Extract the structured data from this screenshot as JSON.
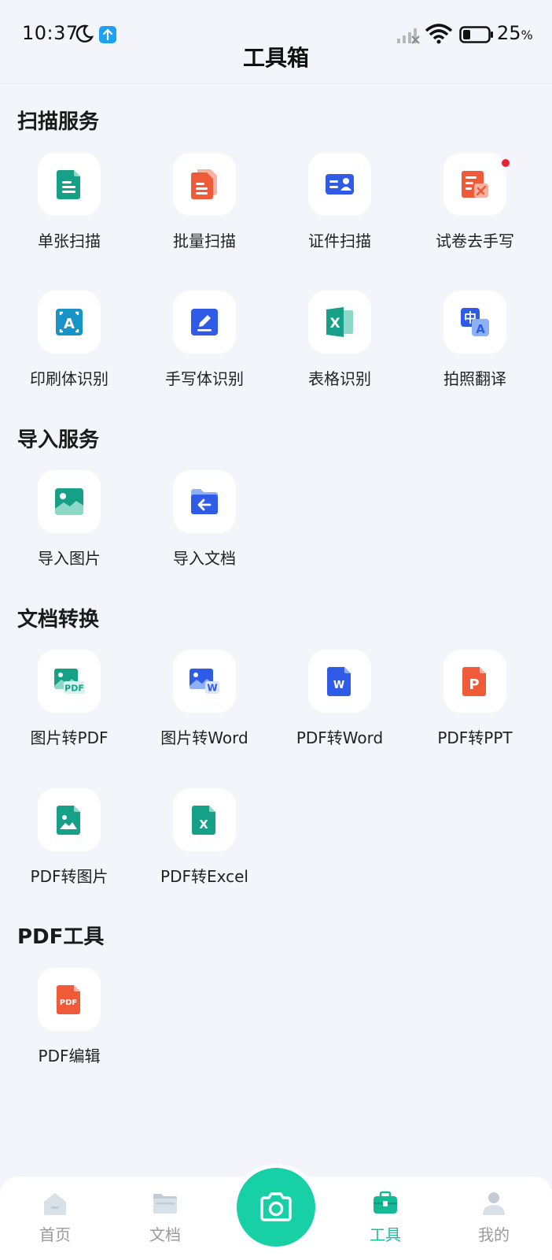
{
  "status_bar": {
    "time": "10:37",
    "battery": "25",
    "battery_unit": "%"
  },
  "header": {
    "title": "工具箱"
  },
  "sections": {
    "scan": {
      "title": "扫描服务",
      "items": [
        "单张扫描",
        "批量扫描",
        "证件扫描",
        "试卷去手写",
        "印刷体识别",
        "手写体识别",
        "表格识别",
        "拍照翻译"
      ]
    },
    "import": {
      "title": "导入服务",
      "items": [
        "导入图片",
        "导入文档"
      ]
    },
    "convert": {
      "title": "文档转换",
      "items": [
        "图片转PDF",
        "图片转Word",
        "PDF转Word",
        "PDF转PPT",
        "PDF转图片",
        "PDF转Excel"
      ]
    },
    "pdf": {
      "title": "PDF工具",
      "items": [
        "PDF编辑"
      ]
    }
  },
  "icon_text": {
    "a": "A",
    "x": "X",
    "zhong": "中",
    "pdf": "PDF",
    "w": "W",
    "p": "P"
  },
  "tab_bar": {
    "items": [
      "首页",
      "文档",
      "工具",
      "我的"
    ],
    "active": "工具"
  },
  "colors": {
    "accent": "#18d0a6",
    "active_tab": "#1abf9d",
    "teal": "#1aa68a",
    "orange": "#f15a37",
    "blue": "#2f5be7",
    "background": "#f3f5fa"
  }
}
